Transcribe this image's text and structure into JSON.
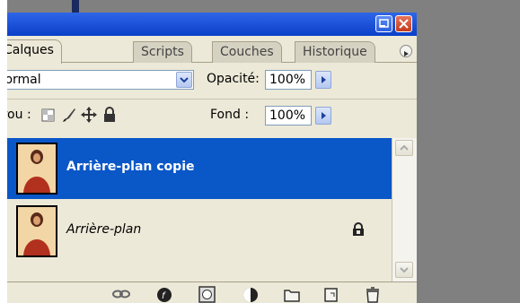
{
  "tabs": [
    {
      "label": "Calques",
      "active": true
    },
    {
      "label": "Scripts",
      "active": false
    },
    {
      "label": "Couches",
      "active": false
    },
    {
      "label": "Historique",
      "active": false
    }
  ],
  "blend_mode": {
    "value": "Normal"
  },
  "opacity": {
    "label": "Opacité:",
    "value": "100%"
  },
  "lock": {
    "label": "Verrou :"
  },
  "fill": {
    "label": "Fond :",
    "value": "100%"
  },
  "layers": [
    {
      "name": "Arrière-plan copie",
      "selected": true,
      "locked": false
    },
    {
      "name": "Arrière-plan",
      "selected": false,
      "locked": true
    }
  ],
  "colors": {
    "selection": "#0a57c8",
    "titlebar": "#0a3fc8",
    "panel_bg": "#ece9d8"
  }
}
